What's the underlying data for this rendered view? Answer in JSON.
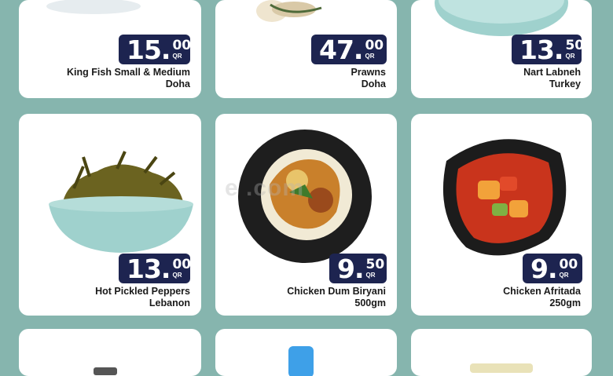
{
  "products": [
    {
      "id": "king-fish",
      "price_main": "15.",
      "price_dec": "00",
      "currency": "QR",
      "name_line1": "King Fish Small & Medium",
      "name_line2": "Doha"
    },
    {
      "id": "prawns",
      "price_main": "47.",
      "price_dec": "00",
      "currency": "QR",
      "name_line1": "Prawns",
      "name_line2": "Doha"
    },
    {
      "id": "nart-labneh",
      "price_main": "13.",
      "price_dec": "50",
      "currency": "QR",
      "name_line1": "Nart Labneh",
      "name_line2": "Turkey"
    },
    {
      "id": "hot-pickled-peppers",
      "price_main": "13.",
      "price_dec": "00",
      "currency": "QR",
      "name_line1": "Hot Pickled Peppers",
      "name_line2": "Lebanon"
    },
    {
      "id": "chicken-dum-biryani",
      "price_main": "9.",
      "price_dec": "50",
      "currency": "QR",
      "name_line1": "Chicken Dum Biryani",
      "name_line2": "500gm"
    },
    {
      "id": "chicken-afritada",
      "price_main": "9.",
      "price_dec": "00",
      "currency": "QR",
      "name_line1": "Chicken Afritada",
      "name_line2": "250gm"
    }
  ],
  "watermark": "e        .com",
  "colors": {
    "background": "#86b5ae",
    "price_tag": "#1d2450",
    "card": "#ffffff"
  }
}
